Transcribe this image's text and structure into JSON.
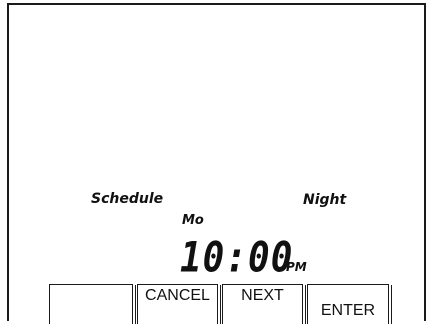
{
  "display": {
    "mode_label": "Schedule",
    "period_label": "Night",
    "day_label": "Mo",
    "time": "10:00",
    "ampm": "PM"
  },
  "softkeys": {
    "key1": "",
    "key2": "CANCEL",
    "key3": "NEXT",
    "key4": "ENTER"
  }
}
